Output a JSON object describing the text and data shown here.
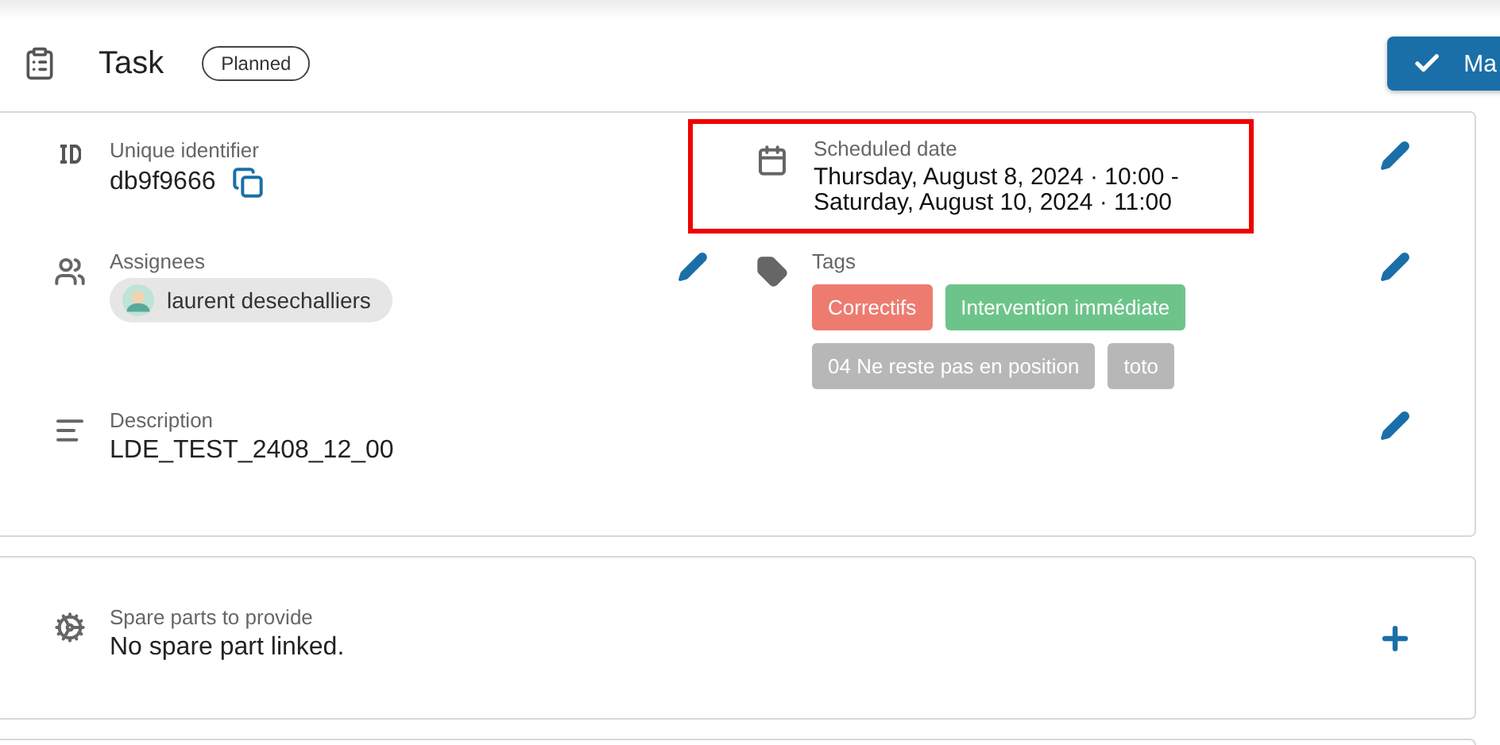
{
  "header": {
    "title": "Task",
    "status": "Planned",
    "action_button": "Ma"
  },
  "details": {
    "identifier": {
      "label": "Unique identifier",
      "value": "db9f9666"
    },
    "schedule": {
      "label": "Scheduled date",
      "lines": [
        "Thursday, August 8, 2024 · 10:00 -",
        "Saturday, August 10, 2024 · 11:00"
      ],
      "highlighted": true
    },
    "assignees": {
      "label": "Assignees",
      "people": [
        "laurent desechalliers"
      ]
    },
    "tags": {
      "label": "Tags",
      "items": [
        {
          "label": "Correctifs",
          "color": "#ee7b70"
        },
        {
          "label": "Intervention immédiate",
          "color": "#6dc48a"
        },
        {
          "label": "04 Ne reste pas en position",
          "color": "#b7b7b7"
        },
        {
          "label": "toto",
          "color": "#b7b7b7"
        }
      ]
    },
    "description": {
      "label": "Description",
      "value": "LDE_TEST_2408_12_00"
    }
  },
  "spare_parts": {
    "label": "Spare parts to provide",
    "value": "No spare part linked."
  }
}
